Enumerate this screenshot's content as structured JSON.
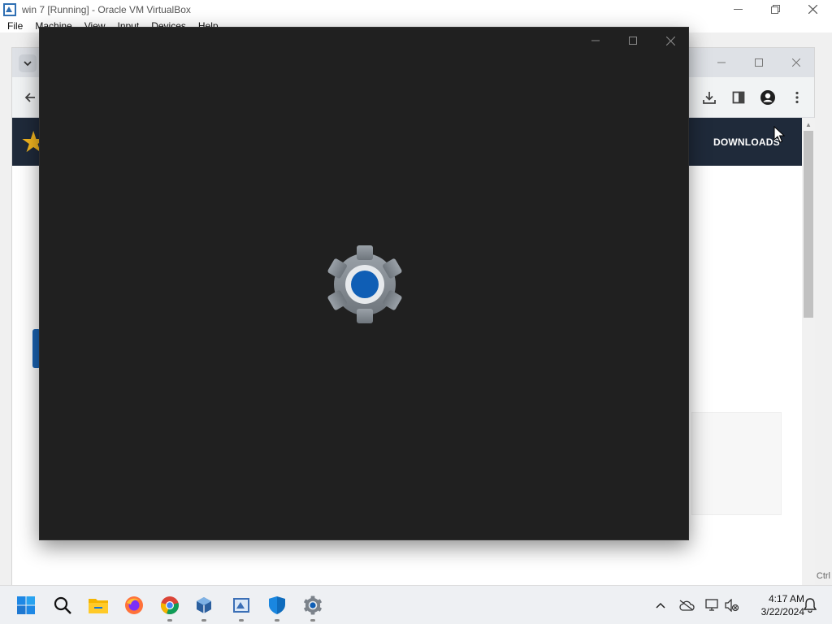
{
  "vbox": {
    "title": "win 7 [Running] - Oracle VM VirtualBox",
    "menu": [
      "File",
      "Machine",
      "View",
      "Input",
      "Devices",
      "Help"
    ],
    "host_key": "Ctrl"
  },
  "browser": {
    "nav_link": "DOWNLOADS"
  },
  "settings_window": {
    "app": "Settings",
    "state": "loading-splash"
  },
  "taskbar": {
    "apps": [
      "start-icon",
      "search-icon",
      "file-explorer-icon",
      "firefox-icon",
      "chrome-icon",
      "virtualbox-icon",
      "vm-icon",
      "defender-icon",
      "settings-icon"
    ],
    "clock_time": "4:17 AM",
    "clock_date": "3/22/2024"
  },
  "colors": {
    "settings_bg": "#202020",
    "accent_blue": "#0f5eb5",
    "site_nav": "#1f2a3a",
    "star": "#f3b61f"
  }
}
